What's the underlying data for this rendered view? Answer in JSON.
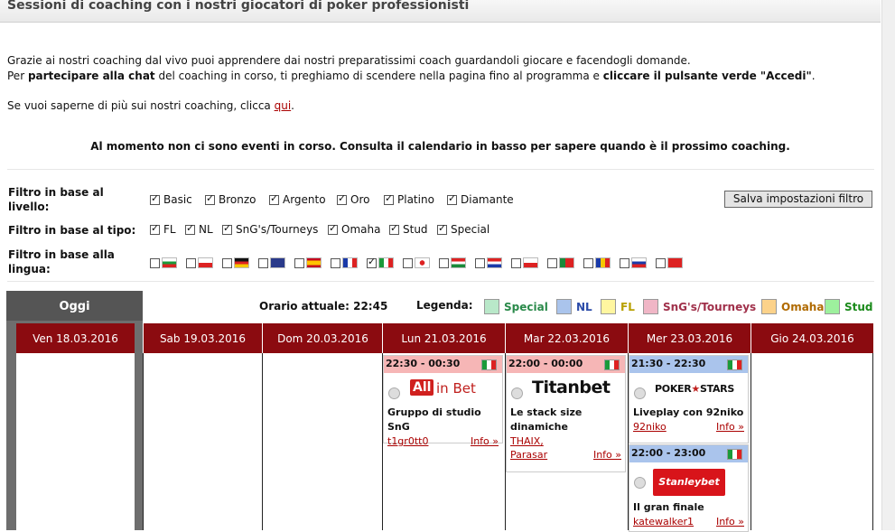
{
  "page_title": "Sessioni di coaching con i nostri giocatori di poker professionisti",
  "intro": {
    "line1": "Grazie ai nostri coaching dal vivo puoi apprendere dai nostri preparatissimi coach guardandoli giocare e facendogli domande.",
    "line2_pre": "Per ",
    "line2_bold1": "partecipare alla chat",
    "line2_mid": " del coaching in corso, ti preghiamo di scendere nella pagina fino al programma e ",
    "line2_bold2": "cliccare il pulsante verde \"Accedi\"",
    "line2_end": ".",
    "line3_pre": "Se vuoi saperne di più sui nostri coaching, clicca ",
    "line3_link": "qui",
    "line3_end": "."
  },
  "notice": "Al momento non ci sono eventi in corso. Consulta il calendario in basso per sapere quando è il prossimo coaching.",
  "filters": {
    "level_label": "Filtro in base al livello:",
    "levels": [
      "Basic",
      "Bronzo",
      "Argento",
      "Oro",
      "Platino",
      "Diamante"
    ],
    "type_label": "Filtro in base al tipo:",
    "types": [
      "FL",
      "NL",
      "SnG's/Tourneys",
      "Omaha",
      "Stud",
      "Special"
    ],
    "lang_label": "Filtro in base alla lingua:",
    "save_button": "Salva impostazioni filtro"
  },
  "calendar": {
    "today_label": "Oggi",
    "current_time_label": "Orario attuale: 22:45",
    "legend_label": "Legenda:",
    "legend": [
      {
        "name": "Special",
        "color": "#b9e8c9",
        "text": "#2a8a4a"
      },
      {
        "name": "NL",
        "color": "#aac4ec",
        "text": "#2a4aa8"
      },
      {
        "name": "FL",
        "color": "#fff6a0",
        "text": "#b8a000"
      },
      {
        "name": "SnG's/Tourneys",
        "color": "#f0b6c6",
        "text": "#a0304a"
      },
      {
        "name": "Omaha",
        "color": "#fcd28a",
        "text": "#b06a00"
      },
      {
        "name": "Stud",
        "color": "#9df09d",
        "text": "#1a8a1a"
      }
    ],
    "days": [
      "Ven 18.03.2016",
      "Sab 19.03.2016",
      "Dom 20.03.2016",
      "Lun 21.03.2016",
      "Mar 22.03.2016",
      "Mer 23.03.2016",
      "Gio 24.03.2016"
    ],
    "events": [
      {
        "time": "22:30 - 00:30",
        "brand": "All in Bet",
        "title": "Gruppo di studio SnG",
        "coach": "t1gr0tt0",
        "coach2": "",
        "info": "Info »",
        "color": "#f6b6b6"
      },
      {
        "time": "22:00 - 00:00",
        "brand": "Titanbet",
        "title": "Le stack size dinamiche",
        "coach": "THAIX,",
        "coach2": "Parasar",
        "info": "Info »",
        "color": "#f6b6b6"
      },
      {
        "time": "21:30 - 22:30",
        "brand": "POKERSTARS",
        "title": "Liveplay con 92niko",
        "coach": "92niko",
        "coach2": "",
        "info": "Info »",
        "color": "#aac4ec"
      },
      {
        "time": "22:00 - 23:00",
        "brand": "Stanleybet",
        "title": "Il gran finale",
        "coach": "katewalker1",
        "coach2": "",
        "info": "Info »",
        "color": "#aac4ec"
      }
    ]
  }
}
